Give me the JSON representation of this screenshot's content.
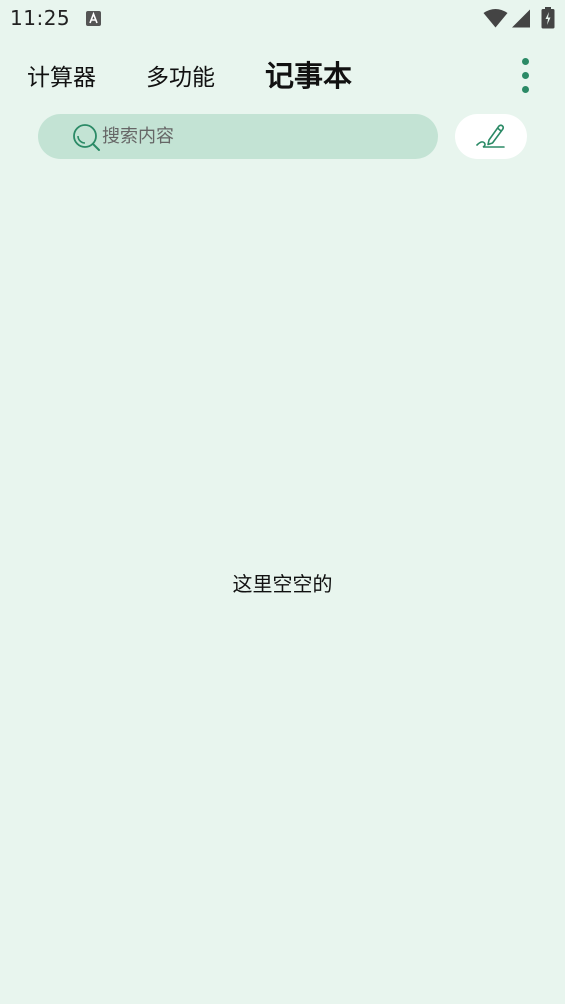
{
  "status_bar": {
    "time": "11:25"
  },
  "tabs": [
    {
      "label": "计算器",
      "active": false
    },
    {
      "label": "多功能",
      "active": false
    },
    {
      "label": "记事本",
      "active": true
    }
  ],
  "search": {
    "placeholder": "搜索内容",
    "value": ""
  },
  "empty_state": {
    "message": "这里空空的"
  },
  "icons": {
    "status": [
      "notification-a-icon",
      "wifi-icon",
      "signal-icon",
      "battery-charging-icon"
    ],
    "toolbar": [
      "more-vert-icon",
      "search-icon",
      "pen-icon"
    ]
  },
  "colors": {
    "background": "#e8f5ee",
    "search_bg": "#c3e3d4",
    "accent": "#2b8a66",
    "button_bg": "#ffffff"
  }
}
